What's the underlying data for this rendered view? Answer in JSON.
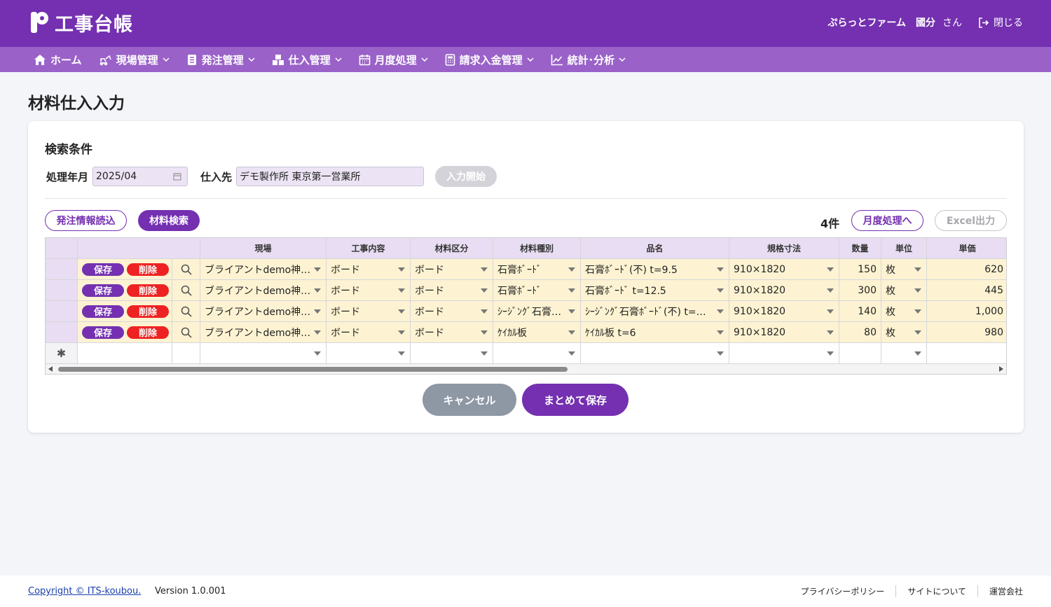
{
  "header": {
    "logo_text": "工事台帳",
    "company": "ぷらっとファーム",
    "user": "國分",
    "user_suffix": "さん",
    "logout_label": "閉じる"
  },
  "nav": [
    {
      "label": "ホーム",
      "icon": "home-icon",
      "has_menu": false
    },
    {
      "label": "現場管理",
      "icon": "excavator-icon",
      "has_menu": true
    },
    {
      "label": "発注管理",
      "icon": "list-icon",
      "has_menu": true
    },
    {
      "label": "仕入管理",
      "icon": "boxes-icon",
      "has_menu": true
    },
    {
      "label": "月度処理",
      "icon": "calendar-icon",
      "has_menu": true
    },
    {
      "label": "請求入金管理",
      "icon": "calculator-icon",
      "has_menu": true
    },
    {
      "label": "統計･分析",
      "icon": "chart-icon",
      "has_menu": true
    }
  ],
  "page_title": "材料仕入入力",
  "search": {
    "section_title": "検索条件",
    "month_label": "処理年月",
    "month_value": "2025/04",
    "supplier_label": "仕入先",
    "supplier_value": "デモ製作所 東京第一営業所",
    "start_label": "入力開始"
  },
  "toolbar": {
    "load_orders_label": "発注情報読込",
    "material_search_label": "材料検索",
    "count_label": "4件",
    "monthly_label": "月度処理へ",
    "excel_label": "Excel出力"
  },
  "grid": {
    "columns": [
      "現場",
      "工事内容",
      "材料区分",
      "材料種別",
      "品名",
      "規格寸法",
      "数量",
      "単位",
      "単価"
    ],
    "save_label": "保存",
    "delete_label": "削除",
    "new_row_marker": "✱",
    "rows": [
      {
        "site": "ブライアントdemo神…",
        "work": "ボード",
        "category": "ボード",
        "type": "石膏ﾎﾞｰﾄﾞ",
        "item": "石膏ﾎﾞｰﾄﾞ(不) t=9.5",
        "size": "910×1820",
        "qty": "150",
        "unit": "枚",
        "price": "620"
      },
      {
        "site": "ブライアントdemo神…",
        "work": "ボード",
        "category": "ボード",
        "type": "石膏ﾎﾞｰﾄﾞ",
        "item": "石膏ﾎﾞｰﾄﾞ t=12.5",
        "size": "910×1820",
        "qty": "300",
        "unit": "枚",
        "price": "445"
      },
      {
        "site": "ブライアントdemo神…",
        "work": "ボード",
        "category": "ボード",
        "type": "ｼｰｼﾞﾝｸﾞ石膏…",
        "item": "ｼｰｼﾞﾝｸﾞ石膏ﾎﾞｰﾄﾞ(不) t=…",
        "size": "910×1820",
        "qty": "140",
        "unit": "枚",
        "price": "1,000"
      },
      {
        "site": "ブライアントdemo神…",
        "work": "ボード",
        "category": "ボード",
        "type": "ｹｲｶﾙ板",
        "item": "ｹｲｶﾙ板 t=6",
        "size": "910×1820",
        "qty": "80",
        "unit": "枚",
        "price": "980"
      }
    ]
  },
  "actions": {
    "cancel_label": "キャンセル",
    "save_all_label": "まとめて保存"
  },
  "footer": {
    "copyright": "Copyright © ITS-koubou.",
    "version": "Version 1.0.001",
    "links": [
      "プライバシーポリシー",
      "サイトについて",
      "運営会社"
    ]
  },
  "colors": {
    "brand": "#7430b0",
    "nav": "#9a62c8",
    "delete": "#ee2222",
    "row_fill": "#fdf3d2",
    "header_fill": "#e8ddf2"
  }
}
